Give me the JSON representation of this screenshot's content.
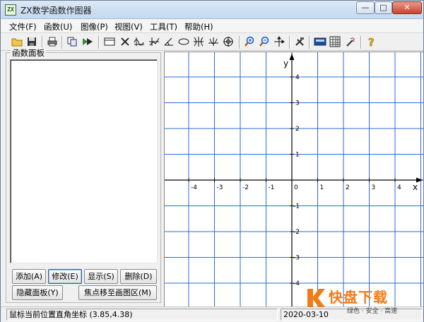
{
  "window": {
    "title": "ZX数学函数作图器",
    "icon_text": "ZX",
    "buttons": {
      "minimize": "—",
      "maximize": "□",
      "close": "✕"
    }
  },
  "menu": {
    "items": [
      "文件(F)",
      "函数(U)",
      "图像(P)",
      "视图(V)",
      "工具(T)",
      "帮助(H)"
    ]
  },
  "toolbar": {
    "icons": [
      "open-folder-icon",
      "save-disk-icon",
      "print-icon",
      "copy-icon",
      "export-icon",
      "canvas-icon",
      "cross-icon",
      "trig-curve-icon",
      "step-icon",
      "angle-icon",
      "ellipse-icon",
      "hyperbola-icon",
      "parabola-icon",
      "target-icon",
      "zoom-in-icon",
      "zoom-out-icon",
      "pan-axes-icon",
      "tools-icon",
      "calculator-icon",
      "grid-table-icon",
      "magic-wand-icon",
      "help-icon"
    ]
  },
  "panel": {
    "title": "函数面板",
    "buttons": {
      "add": "添加(A)",
      "modify": "修改(E)",
      "show": "显示(S)",
      "delete": "删除(D)",
      "hide_panel": "隐藏面板(Y)",
      "focus_to_graph": "焦点移至画图区(M)"
    }
  },
  "graph": {
    "x_axis_label": "x",
    "y_axis_label": "y",
    "x_ticks": [
      "-4",
      "-3",
      "-2",
      "-1",
      "0",
      "1",
      "2",
      "3",
      "4"
    ],
    "y_ticks_positive": [
      "4",
      "3",
      "2",
      "1"
    ],
    "y_ticks_negative": [
      "-1",
      "-2",
      "-3",
      "-4"
    ],
    "grid_color": "#2a6bd4",
    "axis_color": "#000000"
  },
  "status": {
    "coordinate_label": "鼠标当前位置直角坐标 (3.85,4.38)",
    "date": "2020-03-10"
  },
  "watermark": {
    "brand": "快盘下载",
    "tagline": "绿色 · 安全 · 高速",
    "accent": "#f07c18"
  }
}
